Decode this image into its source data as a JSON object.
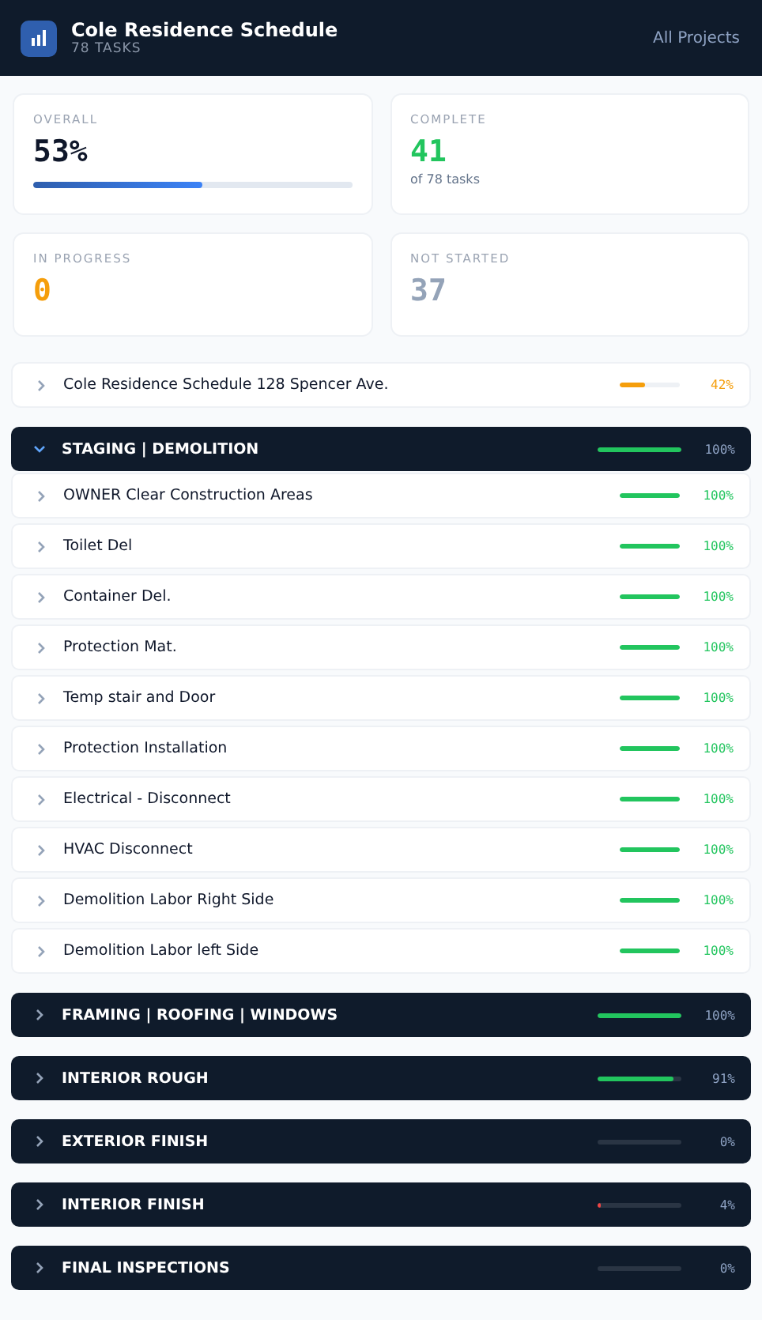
{
  "header": {
    "title": "Cole Residence Schedule",
    "subtitle": "78 TASKS",
    "link": "All Projects"
  },
  "stats": [
    {
      "label": "OVERALL",
      "value": "53%",
      "kind": "progress",
      "level": 0.53
    },
    {
      "label": "COMPLETE",
      "value": "41",
      "kind": "count",
      "color": "#22c55e",
      "note": "of 78 tasks"
    },
    {
      "label": "IN PROGRESS",
      "value": "0",
      "kind": "count",
      "color": "#f59e0b"
    },
    {
      "label": "NOT STARTED",
      "value": "37",
      "kind": "count",
      "color": "#94a3b8"
    }
  ],
  "project": {
    "name": "Cole Residence Schedule 128 Spencer Ave.",
    "level": 0.42,
    "percent": "42%",
    "color": "#f59e0b"
  },
  "sections": [
    {
      "name": "STAGING | DEMOLITION",
      "expanded": true,
      "level": 1,
      "percent": "100%",
      "color": "#22c55e",
      "children": [
        {
          "name": "OWNER Clear Construction Areas",
          "level": 1,
          "percent": "100%",
          "color": "#22c55e"
        },
        {
          "name": "Toilet Del",
          "level": 1,
          "percent": "100%",
          "color": "#22c55e"
        },
        {
          "name": "Container Del.",
          "level": 1,
          "percent": "100%",
          "color": "#22c55e"
        },
        {
          "name": "Protection Mat.",
          "level": 1,
          "percent": "100%",
          "color": "#22c55e"
        },
        {
          "name": "Temp stair and Door",
          "level": 1,
          "percent": "100%",
          "color": "#22c55e"
        },
        {
          "name": "Protection Installation",
          "level": 1,
          "percent": "100%",
          "color": "#22c55e"
        },
        {
          "name": "Electrical - Disconnect",
          "level": 1,
          "percent": "100%",
          "color": "#22c55e"
        },
        {
          "name": "HVAC Disconnect",
          "level": 1,
          "percent": "100%",
          "color": "#22c55e"
        },
        {
          "name": "Demolition Labor Right Side",
          "level": 1,
          "percent": "100%",
          "color": "#22c55e"
        },
        {
          "name": "Demolition Labor left Side",
          "level": 1,
          "percent": "100%",
          "color": "#22c55e"
        }
      ]
    },
    {
      "name": "FRAMING | ROOFING | WINDOWS",
      "expanded": false,
      "level": 1,
      "percent": "100%",
      "color": "#22c55e"
    },
    {
      "name": "INTERIOR ROUGH",
      "expanded": false,
      "level": 0.91,
      "percent": "91%",
      "color": "#22c55e"
    },
    {
      "name": "EXTERIOR FINISH",
      "expanded": false,
      "percent": "0%"
    },
    {
      "name": "INTERIOR FINISH",
      "expanded": false,
      "level": 0.04,
      "percent": "4%",
      "color": "#ef4444"
    },
    {
      "name": "FINAL INSPECTIONS",
      "expanded": false,
      "percent": "0%"
    }
  ]
}
